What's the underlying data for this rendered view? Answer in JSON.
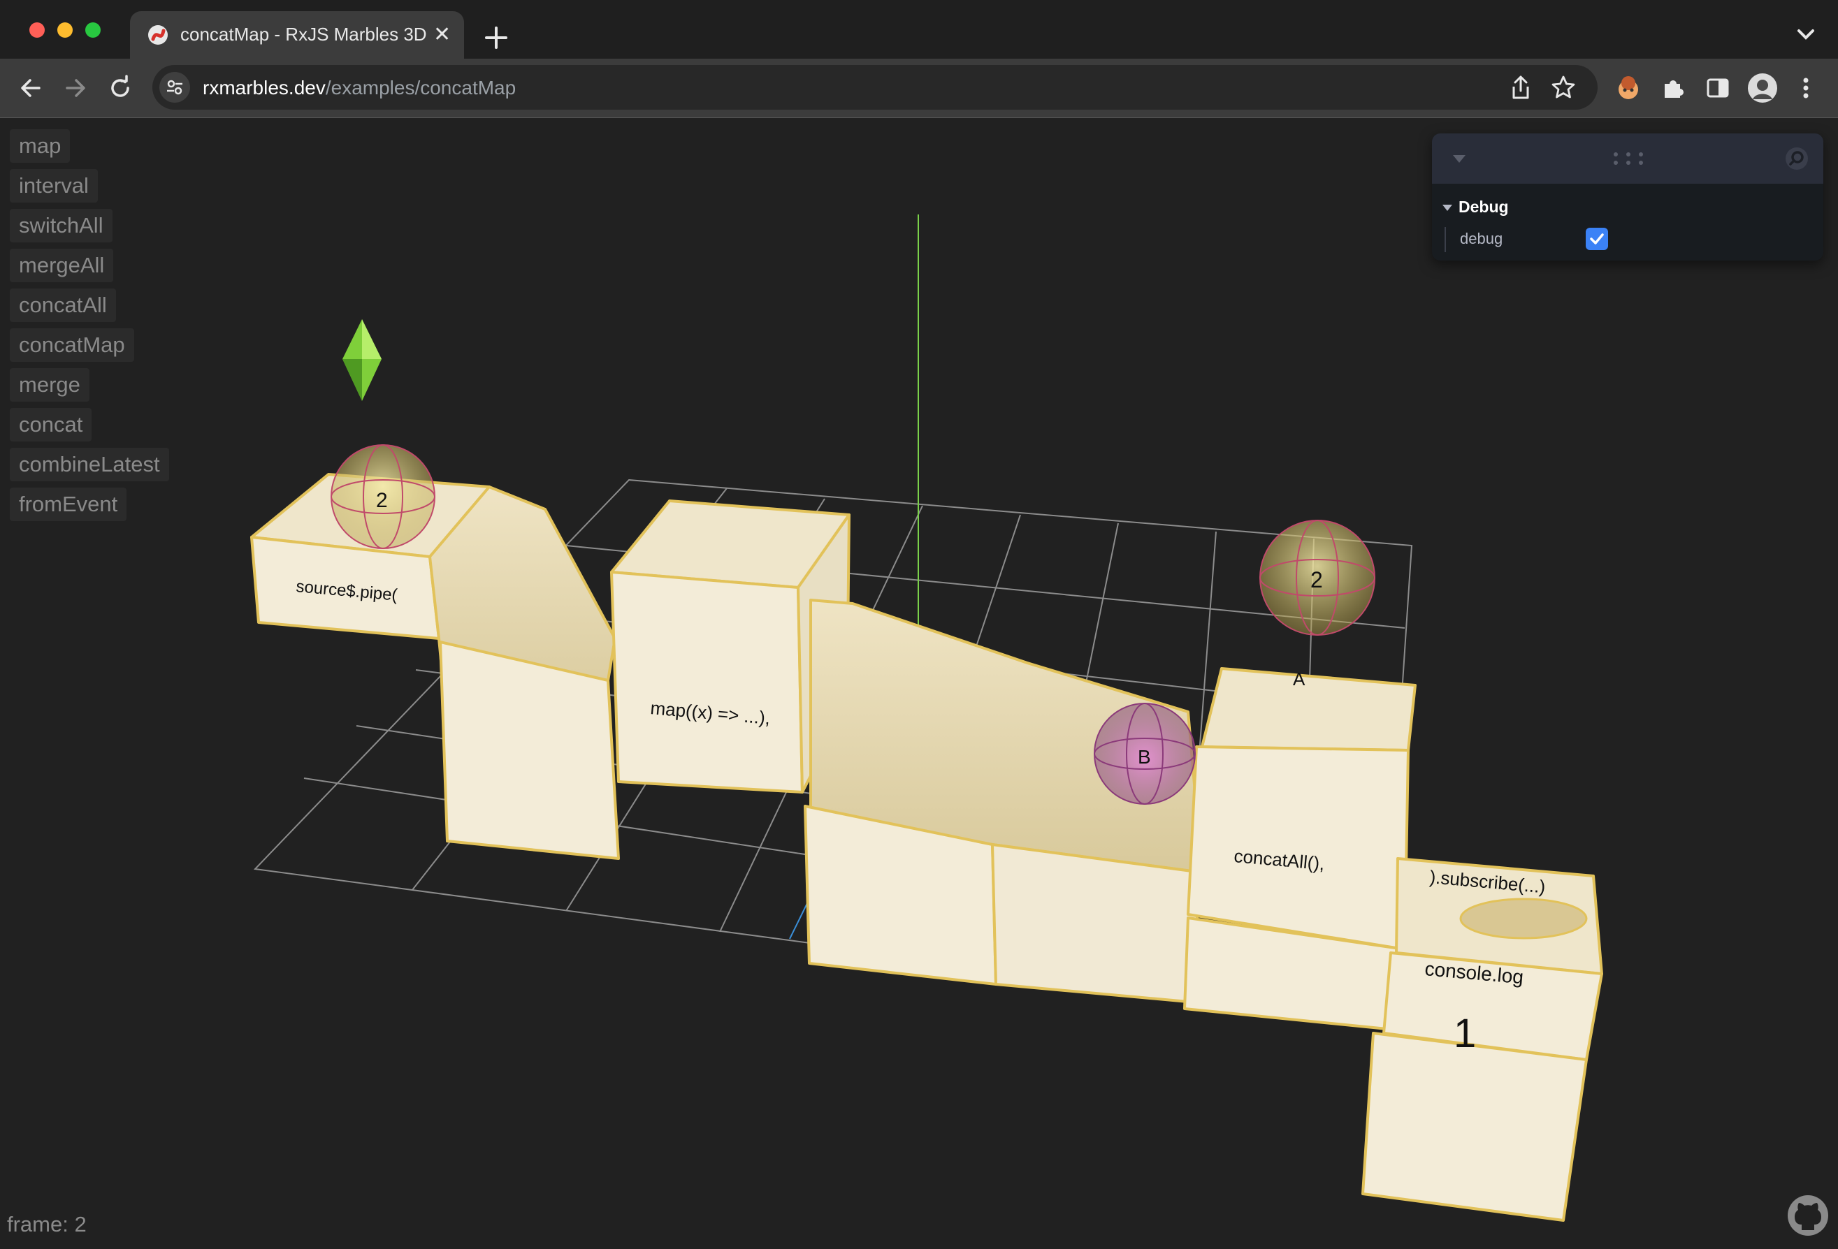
{
  "window": {
    "tab_title": "concatMap - RxJS Marbles 3D",
    "url_host": "rxmarbles.dev",
    "url_path": "/examples/concatMap"
  },
  "nav": {
    "items": [
      "map",
      "interval",
      "switchAll",
      "mergeAll",
      "concatAll",
      "concatMap",
      "merge",
      "concat",
      "combineLatest",
      "fromEvent"
    ]
  },
  "debug_panel": {
    "folder_label": "Debug",
    "debug_label": "debug",
    "debug_checked": true
  },
  "scene": {
    "source_label": "source$.pipe(",
    "map_label": "map((x) => ...),",
    "a_label": "A",
    "concat_label": "concatAll(),",
    "subscribe_label": ").subscribe(...)",
    "console_label": "console.log",
    "console_value": "1",
    "marble_left": "2",
    "marble_right": "2",
    "marble_pink": "B"
  },
  "footer": {
    "frame_label": "frame: 2"
  },
  "colors": {
    "accent_blue": "#3b82f6",
    "block_fill": "#f1e9d4",
    "block_edge": "#e2c25a"
  }
}
